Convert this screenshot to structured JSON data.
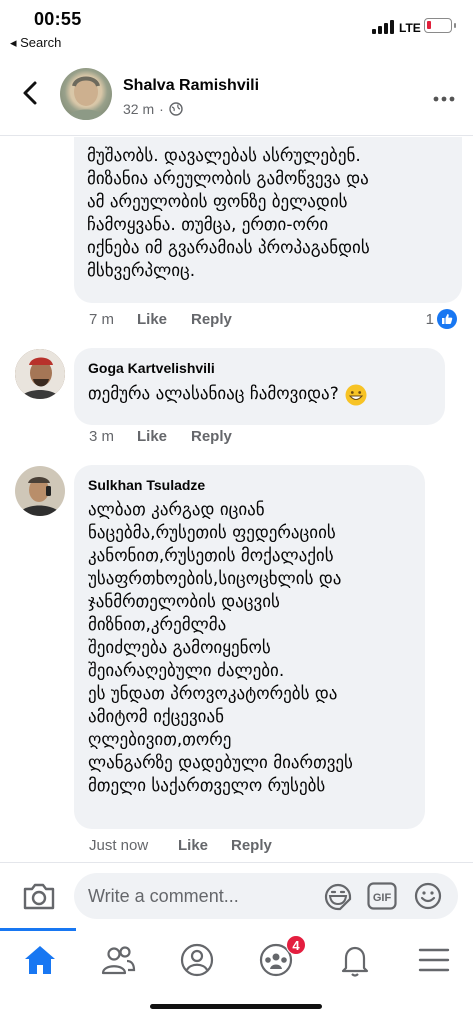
{
  "status_bar": {
    "time": "00:55",
    "back_label": "◂ Search",
    "network": "LTE"
  },
  "header": {
    "name": "Shalva Ramishvili",
    "time": "32 m",
    "separator": "·"
  },
  "comments": [
    {
      "id": "c0",
      "lines": [
        "მუშაობს. დავალებას ასრულებენ.",
        "მიზანია არეულობის გამოწვევა და",
        "ამ არეულობის ფონზე ბელადის",
        "ჩამოყვანა. თუმცა, ერთი-ორი",
        "იქნება იმ გვარამიას პროპაგანდის",
        "მსხვერპლიც."
      ],
      "time": "7 m",
      "like_label": "Like",
      "reply_label": "Reply",
      "reaction_count": "1"
    },
    {
      "id": "c1",
      "author": "Goga Kartvelishvili",
      "text": "თემურა ალასანიაც  ჩამოვიდა?",
      "time": "3 m",
      "like_label": "Like",
      "reply_label": "Reply"
    },
    {
      "id": "c2",
      "author": "Sulkhan Tsuladze",
      "lines": [
        "ალბათ კარგად იციან",
        "ნაცებმა,რუსეთის ფედერაციის",
        "კანონით,რუსეთის მოქალაქის",
        "უსაფრთხოების,სიცოცხლის და",
        "ჯანმრთელობის დაცვის",
        "მიზნით,კრემლმა",
        "შეიძლება გამოიყენოს",
        "შეიარაღებული ძალები.",
        "ეს უნდათ პროვოკატორებს და",
        "ამიტომ იქცევიან",
        "ღლებივით,თორე",
        "ლანგარზე დადებული მიართვეს",
        "მთელი საქართველო რუსებს"
      ],
      "time": "Just now",
      "like_label": "Like",
      "reply_label": "Reply"
    }
  ],
  "composer": {
    "placeholder": "Write a comment...",
    "gif_label": "GIF"
  },
  "bottom_nav": {
    "items": [
      "home-icon",
      "friends-icon",
      "profile-icon",
      "groups-icon",
      "notifications-icon",
      "menu-icon"
    ],
    "groups_badge": "4",
    "active": "home",
    "accent": "#1877f2",
    "badge_color": "#e41e3f"
  }
}
